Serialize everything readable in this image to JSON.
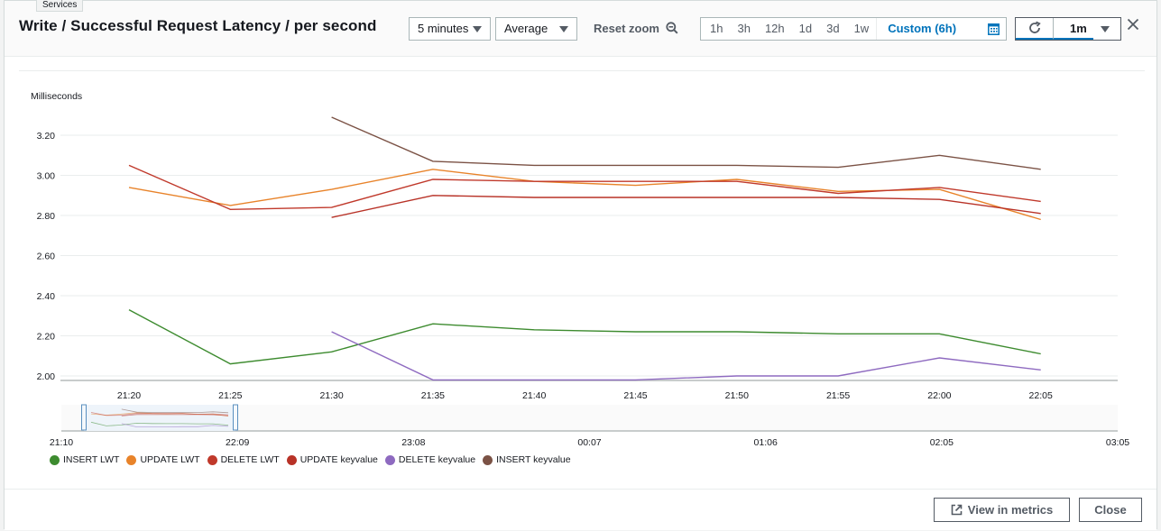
{
  "tooltip": "Services",
  "header": {
    "title": "Write / Successful Request Latency / per second",
    "period_select": "5 minutes",
    "statistic_select": "Average",
    "reset_zoom_label": "Reset zoom",
    "ranges": [
      "1h",
      "3h",
      "12h",
      "1d",
      "3d",
      "1w"
    ],
    "custom_range": "Custom (6h)",
    "refresh_interval": "1m"
  },
  "footer": {
    "view_in_metrics": "View in metrics",
    "close": "Close"
  },
  "colors": {
    "accent": "#0073bb",
    "grid": "#eaeded"
  },
  "chart_data": {
    "type": "line",
    "title": "Write / Successful Request Latency / per second",
    "ylabel": "Milliseconds",
    "xlabel": "",
    "ylim": [
      1.98,
      3.3
    ],
    "yticks": [
      2.0,
      2.2,
      2.4,
      2.6,
      2.8,
      3.0,
      3.2
    ],
    "ytick_labels": [
      "2.00",
      "2.20",
      "2.40",
      "2.60",
      "2.80",
      "3.00",
      "3.20"
    ],
    "x": [
      "21:20",
      "21:25",
      "21:30",
      "21:35",
      "21:40",
      "21:45",
      "21:50",
      "21:55",
      "22:00",
      "22:05"
    ],
    "grid": true,
    "legend_position": "bottom-left",
    "series": [
      {
        "name": "INSERT LWT",
        "color": "#3d8b2f",
        "values": [
          2.33,
          2.06,
          2.12,
          2.26,
          2.23,
          2.22,
          2.22,
          2.21,
          2.21,
          2.11
        ]
      },
      {
        "name": "UPDATE LWT",
        "color": "#e8832a",
        "values": [
          2.94,
          2.85,
          2.93,
          3.03,
          2.97,
          2.95,
          2.98,
          2.92,
          2.93,
          2.78
        ]
      },
      {
        "name": "DELETE LWT",
        "color": "#c0392b",
        "values": [
          3.05,
          2.83,
          2.84,
          2.98,
          2.97,
          2.97,
          2.97,
          2.91,
          2.94,
          2.87
        ]
      },
      {
        "name": "UPDATE keyvalue",
        "color": "#b83227",
        "values": [
          null,
          null,
          2.79,
          2.9,
          2.89,
          2.89,
          2.89,
          2.89,
          2.88,
          2.81
        ]
      },
      {
        "name": "DELETE keyvalue",
        "color": "#8e6ac0",
        "values": [
          null,
          null,
          2.22,
          1.98,
          1.98,
          1.98,
          2.0,
          2.0,
          2.09,
          2.03
        ]
      },
      {
        "name": "INSERT keyvalue",
        "color": "#7b5245",
        "values": [
          null,
          null,
          3.29,
          3.07,
          3.05,
          3.05,
          3.05,
          3.04,
          3.1,
          3.03
        ]
      }
    ],
    "navigator": {
      "tick_labels": [
        "21:10",
        "22:09",
        "23:08",
        "00:07",
        "01:06",
        "02:05",
        "03:05"
      ],
      "selected_range": [
        "21:15",
        "22:09"
      ]
    }
  }
}
